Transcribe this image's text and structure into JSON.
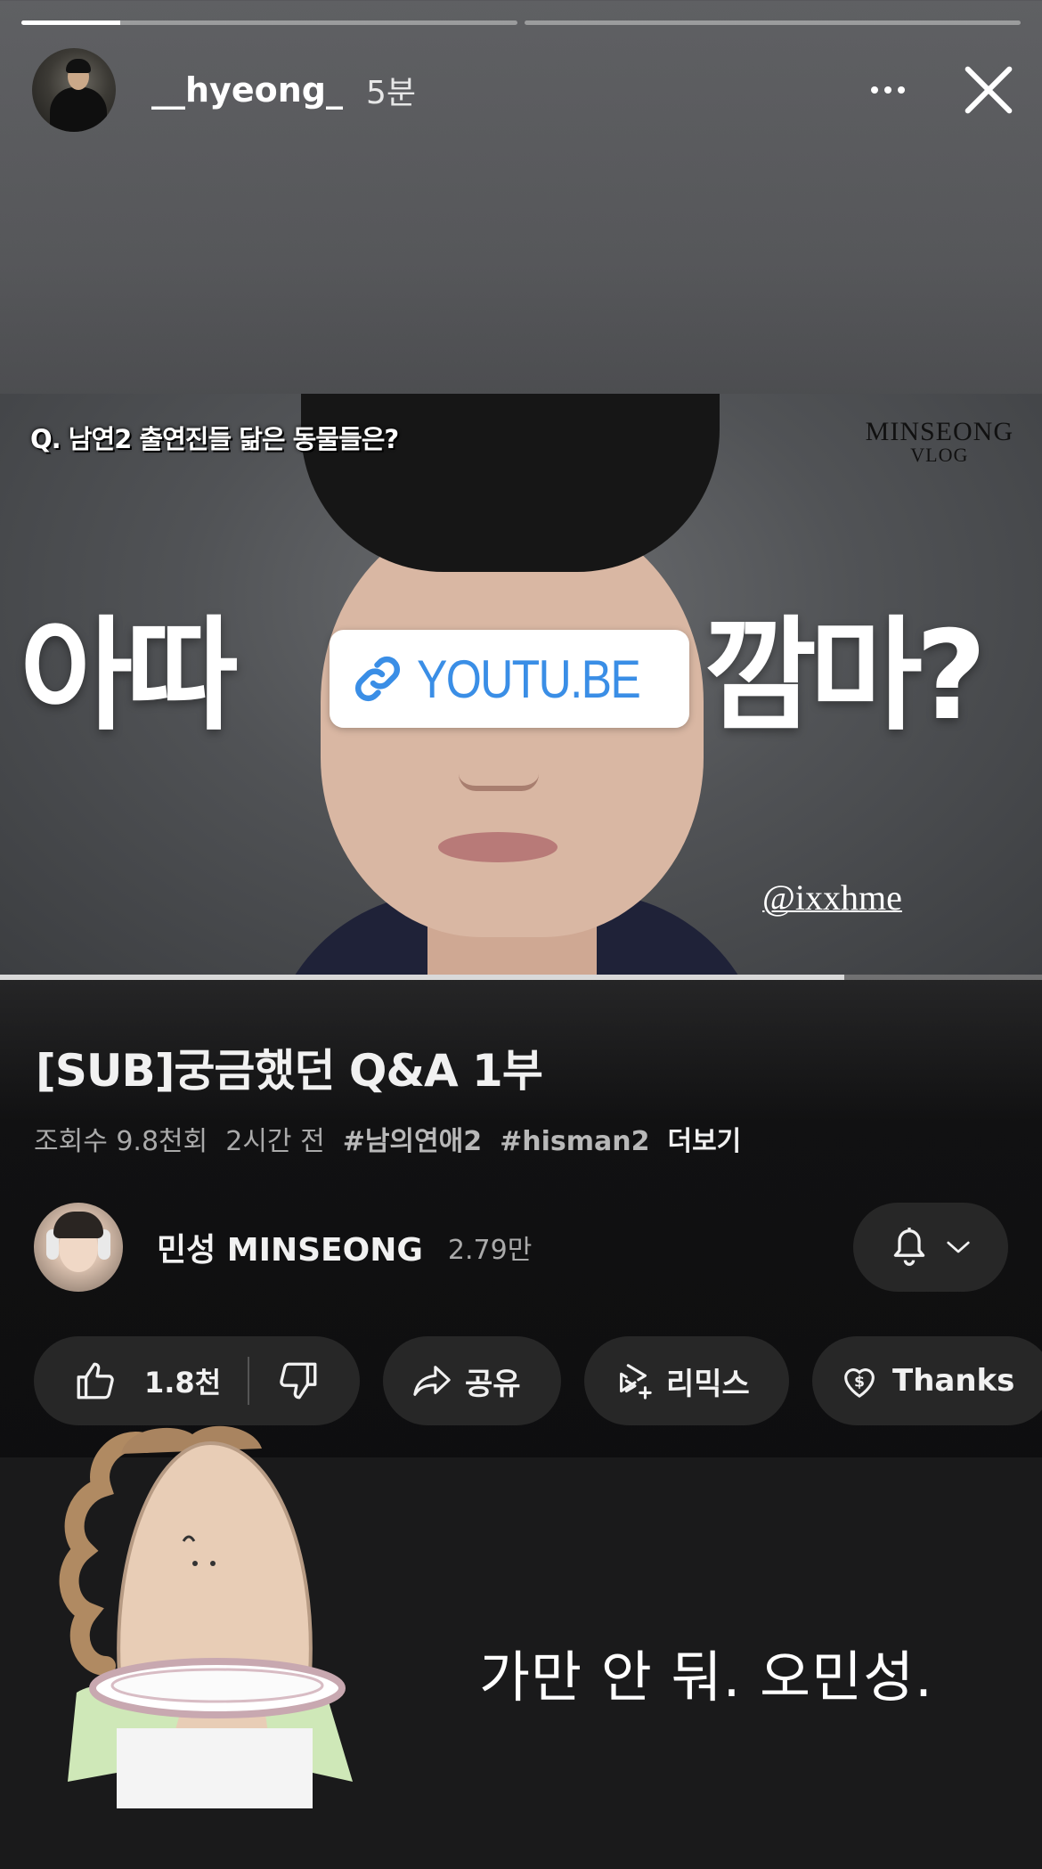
{
  "story": {
    "segments": [
      {
        "progress": 0.2
      },
      {
        "progress": 0.0
      }
    ],
    "username": "__hyeong_",
    "time_ago": "5분"
  },
  "thumbnail": {
    "question": "Q. 남연2 출연진들 닮은 동물들은?",
    "brand_line1": "MINSEONG",
    "brand_line2": "VLOG",
    "big_left": "아따",
    "big_right": "깜마?",
    "handle": "@ixxhme"
  },
  "link_sticker": {
    "text": "YOUTU.BE",
    "icon": "link-icon",
    "color": "#3a8ee6"
  },
  "video_progress": 0.81,
  "video": {
    "title": "[SUB]궁금했던 Q&A 1부",
    "views": "조회수 9.8천회",
    "posted": "2시간 전",
    "tags": [
      "#남의연애2",
      "#hisman2"
    ],
    "more": "더보기"
  },
  "channel": {
    "name": "민성 MINSEONG",
    "subscribers": "2.79만"
  },
  "actions": {
    "like_count": "1.8천",
    "share": "공유",
    "remix": "리믹스",
    "thanks": "Thanks"
  },
  "caption": "가만 안 둬. 오민성."
}
